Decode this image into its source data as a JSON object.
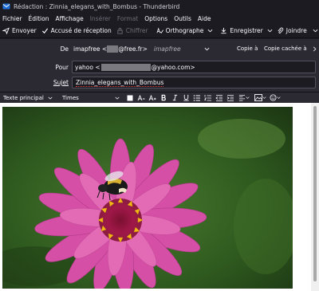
{
  "window": {
    "title": "Rédaction : Zinnia_elegans_with_Bombus - Thunderbird"
  },
  "menubar": [
    {
      "id": "fichier",
      "label": "Fichier",
      "disabled": false
    },
    {
      "id": "edition",
      "label": "Édition",
      "disabled": false
    },
    {
      "id": "affichage",
      "label": "Affichage",
      "disabled": false
    },
    {
      "id": "inserer",
      "label": "Insérer",
      "disabled": true
    },
    {
      "id": "format",
      "label": "Format",
      "disabled": true
    },
    {
      "id": "options",
      "label": "Options",
      "disabled": false
    },
    {
      "id": "outils",
      "label": "Outils",
      "disabled": false
    },
    {
      "id": "aide",
      "label": "Aide",
      "disabled": false
    }
  ],
  "toolbar": {
    "send_label": "Envoyer",
    "receipt_label": "Accusé de réception",
    "encrypt_label": "Chiffrer",
    "spelling_label": "Orthographe",
    "save_label": "Enregistrer",
    "attach_label": "Joindre"
  },
  "header": {
    "from_label": "De",
    "from_user": "imapfree",
    "from_domain": "@free.fr>",
    "from_identity": "imapfree",
    "cc_label": "Copie à",
    "bcc_label": "Copie cachée à",
    "to_label": "Pour",
    "to_name": "yahoo <",
    "to_domain": "@yahoo.com>",
    "subject_label": "Sujet",
    "subject_value": "Zinnia_elegans_with_Bombus"
  },
  "format_bar": {
    "paragraph_style": "Texte principal",
    "font": "Times"
  },
  "colors": {
    "window_bg": "#1c1b22",
    "header_bg": "#2b2a33",
    "field_border": "#52515e",
    "disabled_text": "#6d6c75",
    "petal_pink": "#d64fa6",
    "center_yellow": "#f1b818"
  }
}
